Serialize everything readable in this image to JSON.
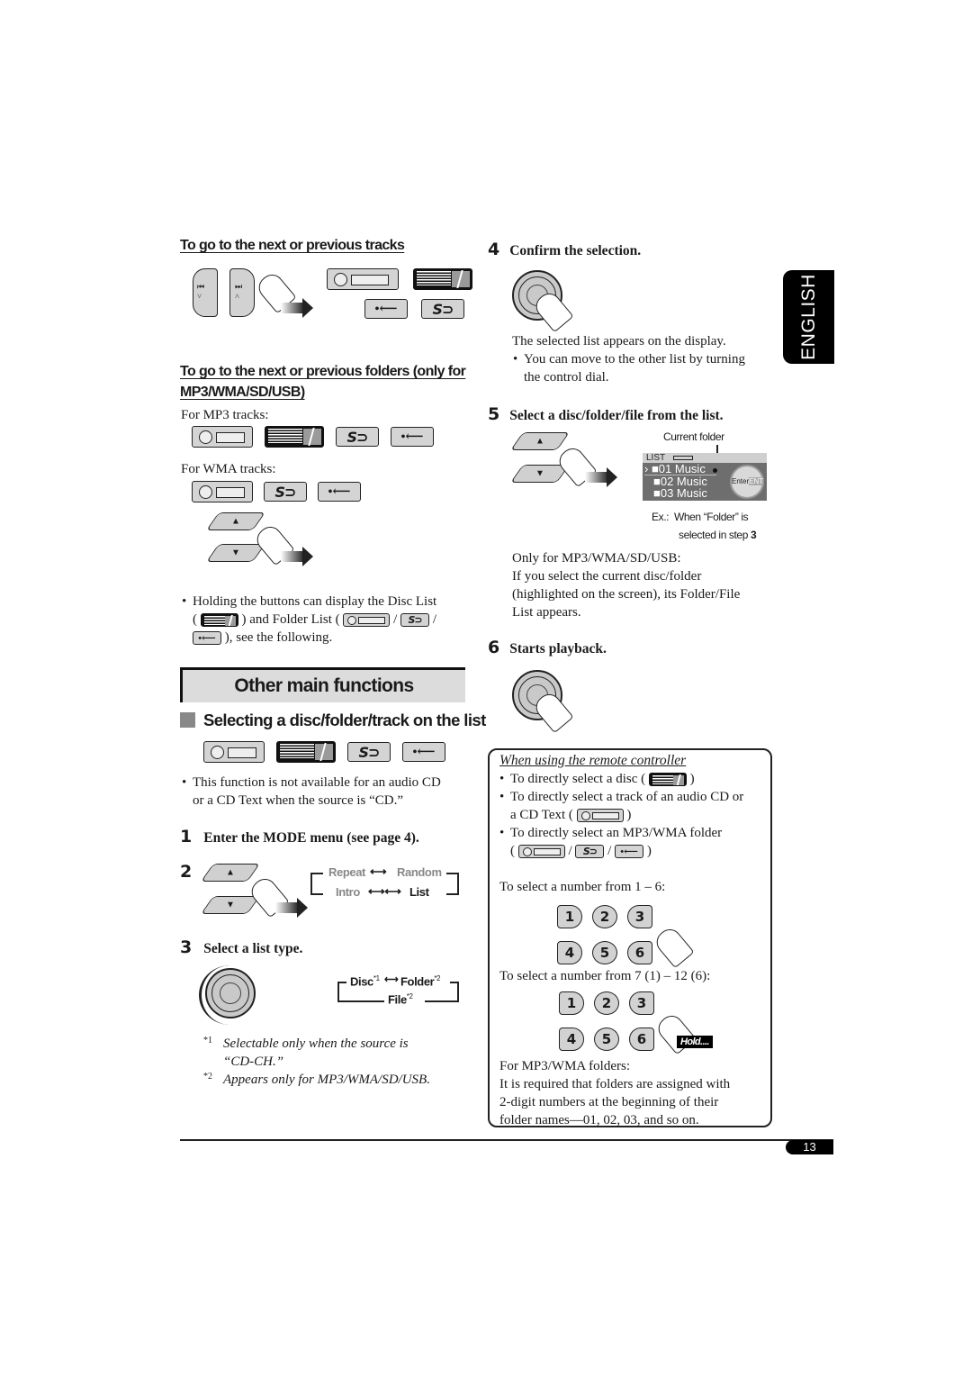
{
  "language_tab": "ENGLISH",
  "page_number": "13",
  "left": {
    "next_prev_tracks": {
      "heading": "To go to the next or previous tracks",
      "prev_button_icon": "prev-track",
      "next_button_icon": "next-track",
      "source_icons": [
        "cd",
        "cd-changer",
        "usb",
        "sd"
      ]
    },
    "next_prev_folders": {
      "heading_line1": "To go to the next or previous folders (only for",
      "heading_line2": "MP3/WMA/SD/USB)",
      "mp3_label": "For MP3 tracks:",
      "mp3_icons": [
        "cd",
        "cd-changer",
        "sd",
        "usb"
      ],
      "wma_label": "For WMA tracks:",
      "wma_icons": [
        "cd",
        "sd",
        "usb"
      ],
      "note_line1": "Holding the buttons can display the Disc List",
      "note_line2a": "(",
      "note_line2b": ") and Folder List (",
      "note_line2c": "/",
      "note_line2d": "/",
      "note_line3": "), see the following."
    },
    "section_title": "Other main functions",
    "subsection_title": "Selecting a disc/folder/track on the list",
    "subsection_icons": [
      "cd",
      "cd-changer",
      "sd",
      "usb"
    ],
    "not_available_note_line1": "This function is not available for an audio CD",
    "not_available_note_line2": "or a CD Text when the source is “CD.”",
    "steps": [
      {
        "num": "1",
        "title": "Enter the MODE menu (see page 4)."
      },
      {
        "num": "2",
        "title": ""
      },
      {
        "num": "3",
        "title": "Select a list type."
      }
    ],
    "mode_flow": {
      "repeat": "Repeat",
      "random": "Random",
      "intro": "Intro",
      "list": "List"
    },
    "list_flow": {
      "disc": "Disc",
      "disc_sup": "*1",
      "folder": "Folder",
      "folder_sup": "*2",
      "file": "File",
      "file_sup": "*2"
    },
    "footnotes": [
      {
        "mark": "*1",
        "line1": "Selectable only when the source is",
        "line2": "“CD-CH.”"
      },
      {
        "mark": "*2",
        "line1": "Appears only for MP3/WMA/SD/USB.",
        "line2": ""
      }
    ]
  },
  "right": {
    "step4": {
      "num": "4",
      "title": "Confirm the selection.",
      "text": "The selected list appears on the display.",
      "bullet_line1": "You can move to the other list by turning",
      "bullet_line2": "the control dial."
    },
    "step5": {
      "num": "5",
      "title": "Select a disc/folder/file from the list.",
      "display": {
        "callout": "Current folder",
        "header": "LIST",
        "items": [
          "01 Music",
          "02 Music",
          "03 Music"
        ],
        "enter_label": "Enter",
        "ent_label": "ENT"
      },
      "caption_ex": "Ex.:",
      "caption_line1": "When “Folder” is",
      "caption_line2": "selected in step",
      "caption_step": "3",
      "note_line1": "Only for MP3/WMA/SD/USB:",
      "note_line2": "If you select the current disc/folder",
      "note_line3": "(highlighted on the screen), its Folder/File",
      "note_line4": "List appears."
    },
    "step6": {
      "num": "6",
      "title": "Starts playback."
    },
    "remote": {
      "title": "When using the remote controller",
      "b1": "To directly select a disc (",
      "b1_end": ")",
      "b2_line1": "To directly select a track of an audio CD or",
      "b2_line2": "a CD Text (",
      "b2_end": ")",
      "b3_line1": "To directly select an MP3/WMA folder",
      "b3_open": "(",
      "b3_sep": "/",
      "b3_end": ")",
      "range1_label": "To select a number from 1 – 6:",
      "keys": [
        "1",
        "2",
        "3",
        "4",
        "5",
        "6"
      ],
      "range2_label": "To select a number from 7 (1) – 12 (6):",
      "hold_label": "Hold....",
      "folders_label": "For MP3/WMA folders:",
      "folders_line1": "It is required that folders are assigned with",
      "folders_line2": "2-digit numbers at the beginning of their",
      "folders_line3": "folder names—01, 02, 03, and so on."
    }
  }
}
